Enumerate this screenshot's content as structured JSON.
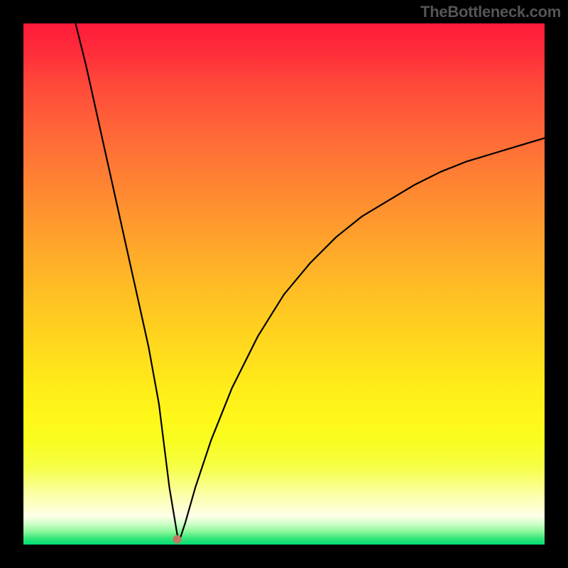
{
  "watermark": {
    "text": "TheBottleneck.com"
  },
  "chart_data": {
    "type": "line",
    "title": "",
    "xlabel": "",
    "ylabel": "",
    "xlim": [
      0,
      100
    ],
    "ylim": [
      0,
      100
    ],
    "background": "vertical-gradient (red-orange-yellow-green) indicating bottleneck severity; green near bottom = minimal bottleneck",
    "series": [
      {
        "name": "bottleneck-curve",
        "x": [
          10,
          12,
          14,
          16,
          18,
          20,
          22,
          24,
          26,
          27,
          28,
          29,
          29.5,
          30,
          31,
          33,
          36,
          40,
          45,
          50,
          55,
          60,
          65,
          70,
          75,
          80,
          85,
          90,
          95,
          100
        ],
        "values": [
          100,
          92,
          83,
          74,
          65,
          56,
          47,
          38,
          27,
          19,
          11,
          5,
          2,
          1,
          4,
          11,
          20,
          30,
          40,
          48,
          54,
          59,
          63,
          66,
          69,
          71.5,
          73.5,
          75,
          76.5,
          78
        ]
      }
    ],
    "marker": {
      "x": 29.5,
      "y": 1,
      "color": "#c47862"
    },
    "grid": false,
    "legend": false
  }
}
